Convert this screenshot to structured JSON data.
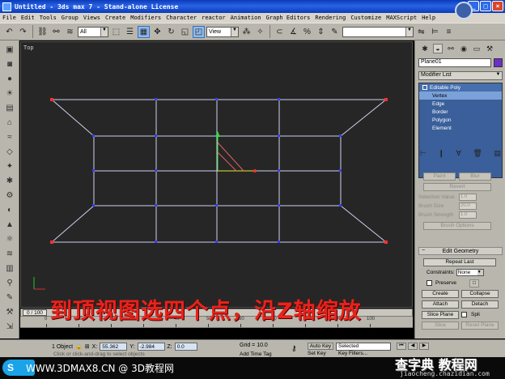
{
  "window": {
    "title": "Untitled - 3ds max 7  - Stand-alone License",
    "minimize": "_",
    "maximize": "□",
    "close": "×"
  },
  "menu": [
    "File",
    "Edit",
    "Tools",
    "Group",
    "Views",
    "Create",
    "Modifiers",
    "Character",
    "reactor",
    "Animation",
    "Graph Editors",
    "Rendering",
    "Customize",
    "MAXScript",
    "Help"
  ],
  "toolbar": {
    "selection_filter": "All",
    "reference_coord": "View"
  },
  "viewport": {
    "label": "Top"
  },
  "command_panel": {
    "object_name": "Plane01",
    "object_color": "#6b2fc8",
    "modifier_list": "Modifier List",
    "stack": {
      "root": "Editable Poly",
      "items": [
        "Vertex",
        "Edge",
        "Border",
        "Polygon",
        "Element"
      ],
      "selected": "Vertex"
    },
    "soft_selection": {
      "paint": "Paint",
      "blur": "Blur",
      "revert": "Revert",
      "selection_value_label": "Selection Value",
      "selection_value": "1.0",
      "brush_size_label": "Brush Size",
      "brush_size": "20.0",
      "brush_strength_label": "Brush Strength",
      "brush_strength": "1.0",
      "brush_options": "Brush Options"
    },
    "edit_geometry": {
      "title": "Edit Geometry",
      "repeat_last": "Repeat Last",
      "constraints_label": "Constraints:",
      "constraints_value": "None",
      "preserve": "Preserve",
      "create": "Create",
      "collapse": "Collapse",
      "attach": "Attach",
      "detach": "Detach",
      "slice_plane": "Slice Plane",
      "split": "Spli",
      "slice": "Slice",
      "reset_plane": "Reset Plane"
    }
  },
  "timeline": {
    "slider": "0 / 100",
    "ticks": [
      "0",
      "10",
      "20",
      "30",
      "40",
      "50",
      "60",
      "70",
      "80",
      "90",
      "100"
    ]
  },
  "status": {
    "selection": "1 Object",
    "x_value": "55.362",
    "y_value": "-2.984",
    "z_value": "0.0",
    "grid": "Grid = 10.0",
    "add_time_tag": "Add Time Tag",
    "auto_key": "Auto Key",
    "selected": "Selected",
    "set_key": "Set Key",
    "key_filters": "Key Filters...",
    "prompt": "Click or click-and-drag to select objects"
  },
  "overlay_caption": "到顶视图选四个点，沿Z轴缩放",
  "watermark": {
    "badge": "S",
    "left": "WWW.3DMAX8.CN @ 3D教程网",
    "right_line1": "查字典 教程网",
    "right_line2": "jiaocheng.chazidian.com"
  }
}
